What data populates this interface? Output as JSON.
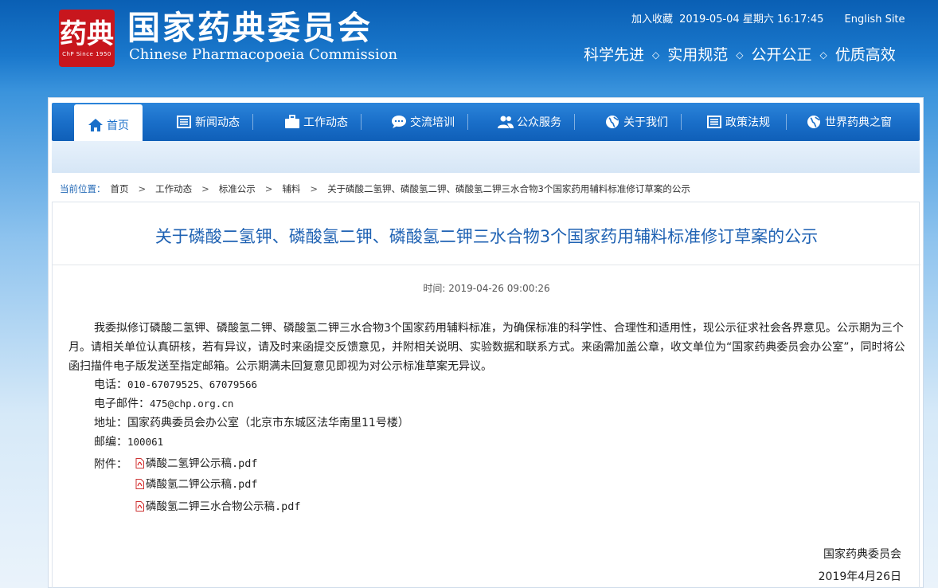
{
  "header": {
    "logo_title_cn": "国家药典委员会",
    "logo_title_en": "Chinese Pharmacopoeia Commission",
    "seal_glyph": "药典",
    "seal_subtitle": "ChP Since 1950",
    "bookmark": "加入收藏",
    "datetime": "2019-05-04 星期六 16:17:45",
    "english_site": "English Site",
    "slogans": [
      "科学先进",
      "实用规范",
      "公开公正",
      "优质高效"
    ],
    "slogan_separator": "◇"
  },
  "nav": {
    "items": [
      {
        "label": "首页",
        "icon": "home-icon"
      },
      {
        "label": "新闻动态",
        "icon": "news-icon"
      },
      {
        "label": "工作动态",
        "icon": "briefcase-icon"
      },
      {
        "label": "交流培训",
        "icon": "chat-icon"
      },
      {
        "label": "公众服务",
        "icon": "users-icon"
      },
      {
        "label": "关于我们",
        "icon": "globe-icon"
      },
      {
        "label": "政策法规",
        "icon": "list-icon"
      },
      {
        "label": "世界药典之窗",
        "icon": "globe-icon"
      }
    ],
    "active_index": 0
  },
  "breadcrumb": {
    "label": "当前位置：",
    "separator": ">",
    "items": [
      "首页",
      "工作动态",
      "标准公示",
      "辅料",
      "关于磷酸二氢钾、磷酸氢二钾、磷酸氢二钾三水合物3个国家药用辅料标准修订草案的公示"
    ]
  },
  "article": {
    "title": "关于磷酸二氢钾、磷酸氢二钾、磷酸氢二钾三水合物3个国家药用辅料标准修订草案的公示",
    "time": "时间: 2019-04-26 09:00:26",
    "paragraph": "我委拟修订磷酸二氢钾、磷酸氢二钾、磷酸氢二钾三水合物3个国家药用辅料标准，为确保标准的科学性、合理性和适用性，现公示征求社会各界意见。公示期为三个月。请相关单位认真研核，若有异议，请及时来函提交反馈意见，并附相关说明、实验数据和联系方式。来函需加盖公章，收文单位为“国家药典委员会办公室”，同时将公函扫描件电子版发送至指定邮箱。公示期满未回复意见即视为对公示标准草案无异议。",
    "contact": {
      "phone_label": "电话：",
      "phone": "010-67079525、67079566",
      "email_label": "电子邮件：",
      "email": "475@chp.org.cn",
      "address_label": "地址：",
      "address": "国家药典委员会办公室（北京市东城区法华南里11号楼）",
      "zip_label": "邮编：",
      "zip": "100061"
    },
    "attachments_label": "附件：",
    "attachments": [
      "磷酸二氢钾公示稿.pdf",
      "磷酸氢二钾公示稿.pdf",
      "磷酸氢二钾三水合物公示稿.pdf"
    ],
    "sign_org": "国家药典委员会",
    "sign_date": "2019年4月26日"
  },
  "colors": {
    "brand_blue": "#1a6fc9",
    "title_blue": "#1f62b3",
    "seal_red": "#c8161d"
  }
}
